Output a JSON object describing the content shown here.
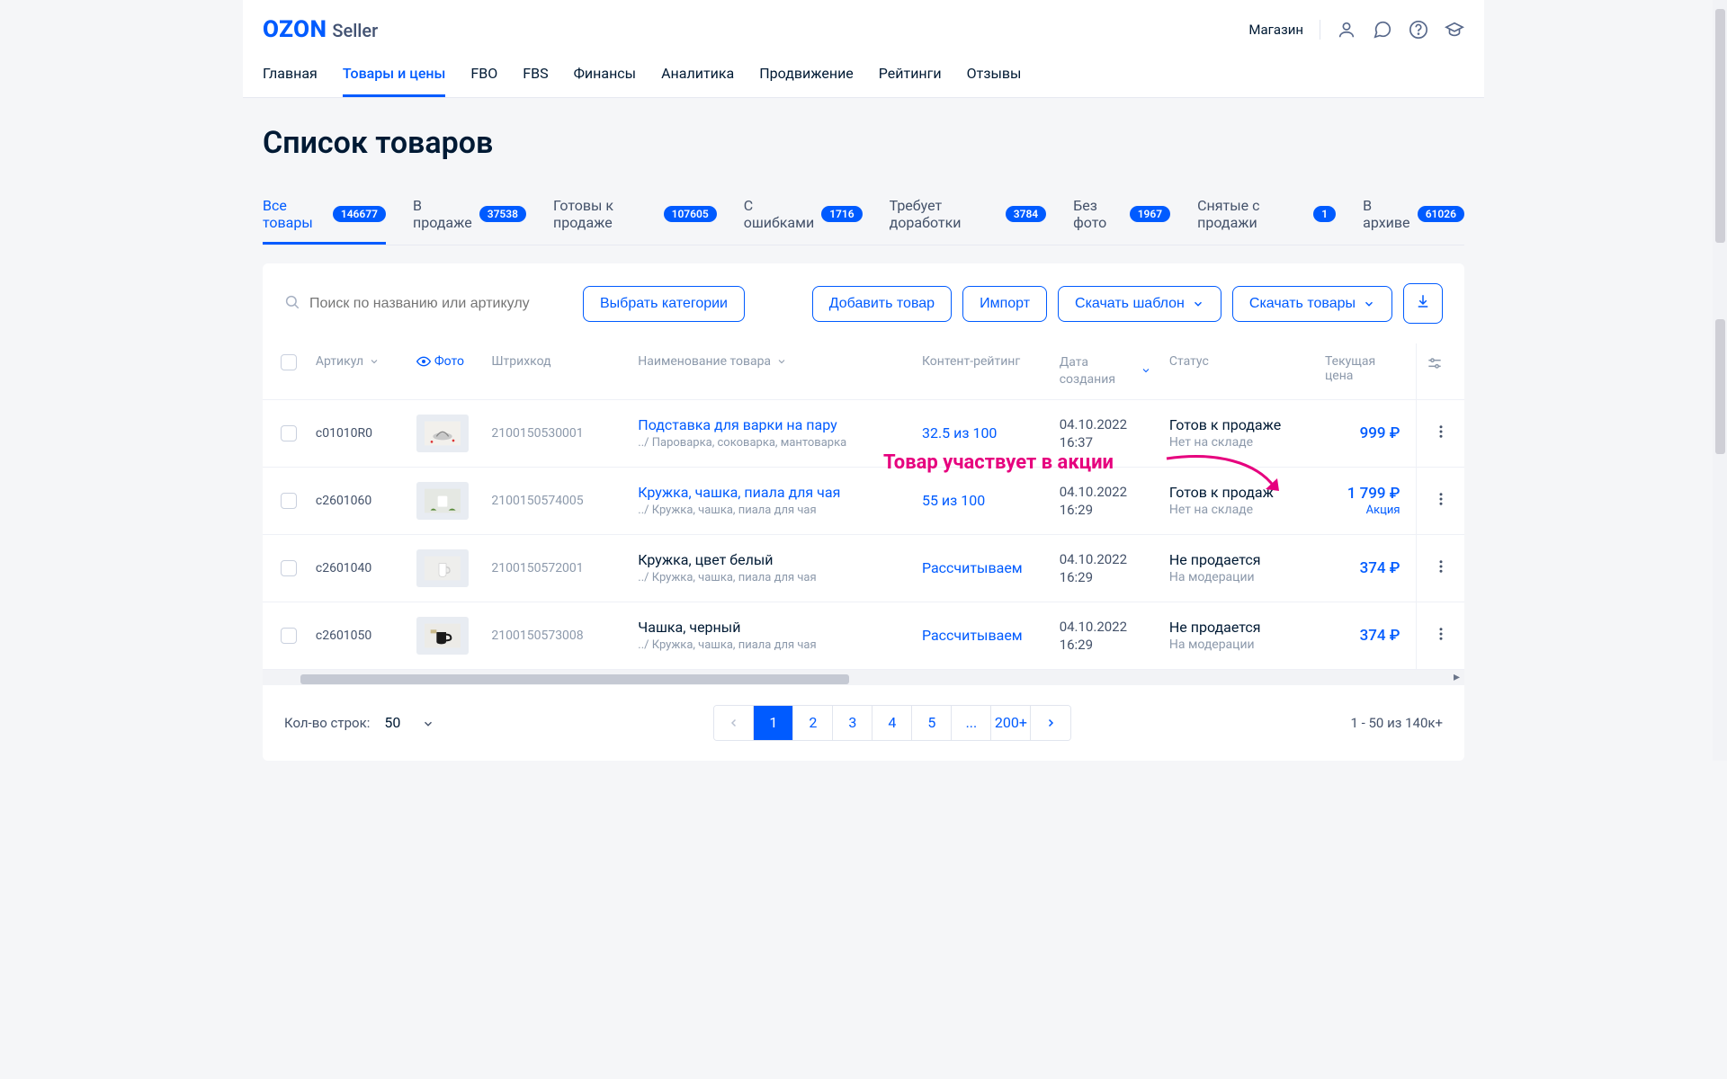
{
  "header": {
    "logo_ozon": "OZON",
    "logo_seller": "Seller",
    "shop": "Магазин"
  },
  "topnav": [
    {
      "label": "Главная",
      "active": false
    },
    {
      "label": "Товары и цены",
      "active": true
    },
    {
      "label": "FBO",
      "active": false
    },
    {
      "label": "FBS",
      "active": false
    },
    {
      "label": "Финансы",
      "active": false
    },
    {
      "label": "Аналитика",
      "active": false
    },
    {
      "label": "Продвижение",
      "active": false
    },
    {
      "label": "Рейтинги",
      "active": false
    },
    {
      "label": "Отзывы",
      "active": false
    }
  ],
  "page_title": "Список товаров",
  "status_tabs": [
    {
      "label": "Все товары",
      "count": "146677",
      "active": true
    },
    {
      "label": "В продаже",
      "count": "37538"
    },
    {
      "label": "Готовы к продаже",
      "count": "107605"
    },
    {
      "label": "С ошибками",
      "count": "1716"
    },
    {
      "label": "Требует доработки",
      "count": "3784"
    },
    {
      "label": "Без фото",
      "count": "1967"
    },
    {
      "label": "Снятые с продажи",
      "count": "1"
    },
    {
      "label": "В архиве",
      "count": "61026"
    }
  ],
  "toolbar": {
    "search_placeholder": "Поиск по названию или артикулу",
    "choose_categories": "Выбрать категории",
    "add_product": "Добавить товар",
    "import": "Импорт",
    "download_template": "Скачать шаблон",
    "download_products": "Скачать товары"
  },
  "columns": {
    "sku": "Артикул",
    "photo": "Фото",
    "barcode": "Штрихкод",
    "name": "Наименование товара",
    "rating": "Контент-рейтинг",
    "date": "Дата создания",
    "status": "Статус",
    "price": "Текущая цена"
  },
  "rows": [
    {
      "sku": "c01010R0",
      "barcode": "2100150530001",
      "name": "Подставка для варки на пару",
      "cat": "../ Пароварка, соковарка, мантоварка",
      "name_link": true,
      "rating": "32.5 из 100",
      "date": "04.10.2022 16:37",
      "status": "Готов к продаже",
      "status_sub": "Нет на складе",
      "price": "999 ₽",
      "promo": ""
    },
    {
      "sku": "c2601060",
      "barcode": "2100150574005",
      "name": "Кружка, чашка, пиала для чая",
      "cat": "../ Кружка, чашка, пиала для чая",
      "name_link": true,
      "rating": "55 из 100",
      "date": "04.10.2022 16:29",
      "status": "Готов к продаж",
      "status_sub": "Нет на складе",
      "price": "1 799 ₽",
      "promo": "Акция"
    },
    {
      "sku": "c2601040",
      "barcode": "2100150572001",
      "name": "Кружка, цвет белый",
      "cat": "../ Кружка, чашка, пиала для чая",
      "name_link": false,
      "rating": "Рассчитываем",
      "date": "04.10.2022 16:29",
      "status": "Не продается",
      "status_sub": "На модерации",
      "price": "374 ₽",
      "promo": ""
    },
    {
      "sku": "c2601050",
      "barcode": "2100150573008",
      "name": "Чашка, черный",
      "cat": "../ Кружка, чашка, пиала для чая",
      "name_link": false,
      "rating": "Рассчитываем",
      "date": "04.10.2022 16:29",
      "status": "Не продается",
      "status_sub": "На модерации",
      "price": "374 ₽",
      "promo": ""
    }
  ],
  "annotation": "Товар участвует в акции",
  "footer": {
    "rows_label": "Кол-во строк:",
    "rows_value": "50",
    "pages": [
      "1",
      "2",
      "3",
      "4",
      "5",
      "...",
      "200+"
    ],
    "active_page": 0,
    "count": "1 - 50 из 140к+"
  }
}
